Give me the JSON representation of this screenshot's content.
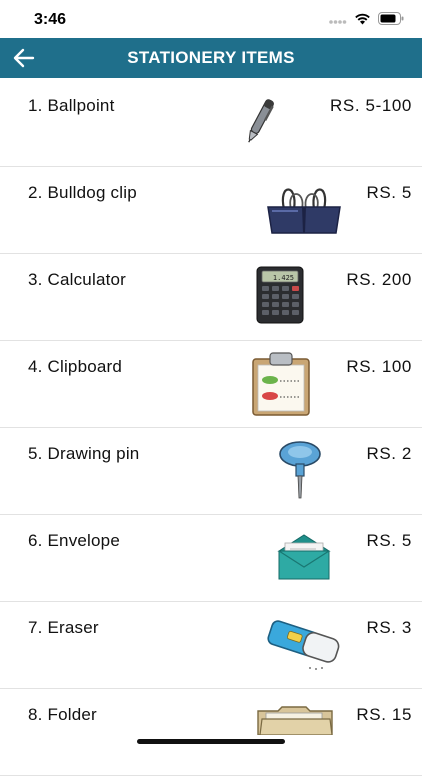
{
  "status_bar": {
    "time": "3:46"
  },
  "header": {
    "title": "STATIONERY ITEMS",
    "back_icon": "arrow-left-icon"
  },
  "items": [
    {
      "label": "1.  Ballpoint",
      "price": "RS.  5-100",
      "icon": "ballpoint-pen-icon"
    },
    {
      "label": "2.  Bulldog clip",
      "price": "RS.  5",
      "icon": "bulldog-clip-icon"
    },
    {
      "label": "3.  Calculator",
      "price": "RS.  200",
      "icon": "calculator-icon"
    },
    {
      "label": "4.  Clipboard",
      "price": "RS.  100",
      "icon": "clipboard-icon"
    },
    {
      "label": "5.  Drawing pin",
      "price": "RS.  2",
      "icon": "drawing-pin-icon"
    },
    {
      "label": "6.  Envelope",
      "price": "RS.  5",
      "icon": "envelope-icon"
    },
    {
      "label": "7.  Eraser",
      "price": "RS.  3",
      "icon": "eraser-icon"
    },
    {
      "label": "8.  Folder",
      "price": "RS.  15",
      "icon": "folder-icon"
    }
  ],
  "colors": {
    "header_bg": "#1f6f8b",
    "header_text": "#ffffff",
    "divider": "#e2e2e2"
  }
}
